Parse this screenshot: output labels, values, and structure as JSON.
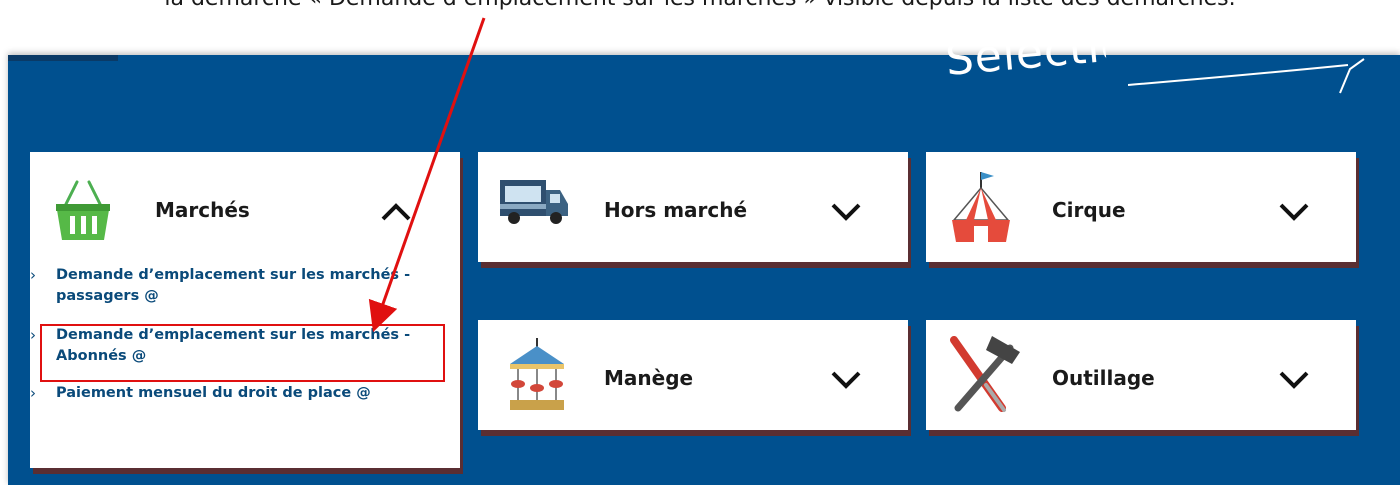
{
  "caption": "la démarche « Demande d’emplacement sur les marchés » visible depuis la liste des démarches.",
  "banner_text": "Sélectionnez",
  "colors": {
    "background": "#00508f",
    "highlight": "#e01010",
    "link": "#0a4a7a",
    "shadow": "#5a2e32"
  },
  "categories": [
    {
      "title": "Marchés",
      "icon": "basket-icon",
      "expanded": true
    },
    {
      "title": "Hors marché",
      "icon": "food-truck-icon",
      "expanded": false
    },
    {
      "title": "Cirque",
      "icon": "circus-tent-icon",
      "expanded": false
    },
    {
      "title": "Manège",
      "icon": "carousel-icon",
      "expanded": false
    },
    {
      "title": "Outillage",
      "icon": "tools-icon",
      "expanded": false
    }
  ],
  "marches_links": [
    {
      "label": "Demande d’emplacement sur les marchés - passagers @"
    },
    {
      "label": "Demande d’emplacement sur les marchés - Abonnés @"
    },
    {
      "label": "Paiement mensuel du droit de place @"
    }
  ]
}
